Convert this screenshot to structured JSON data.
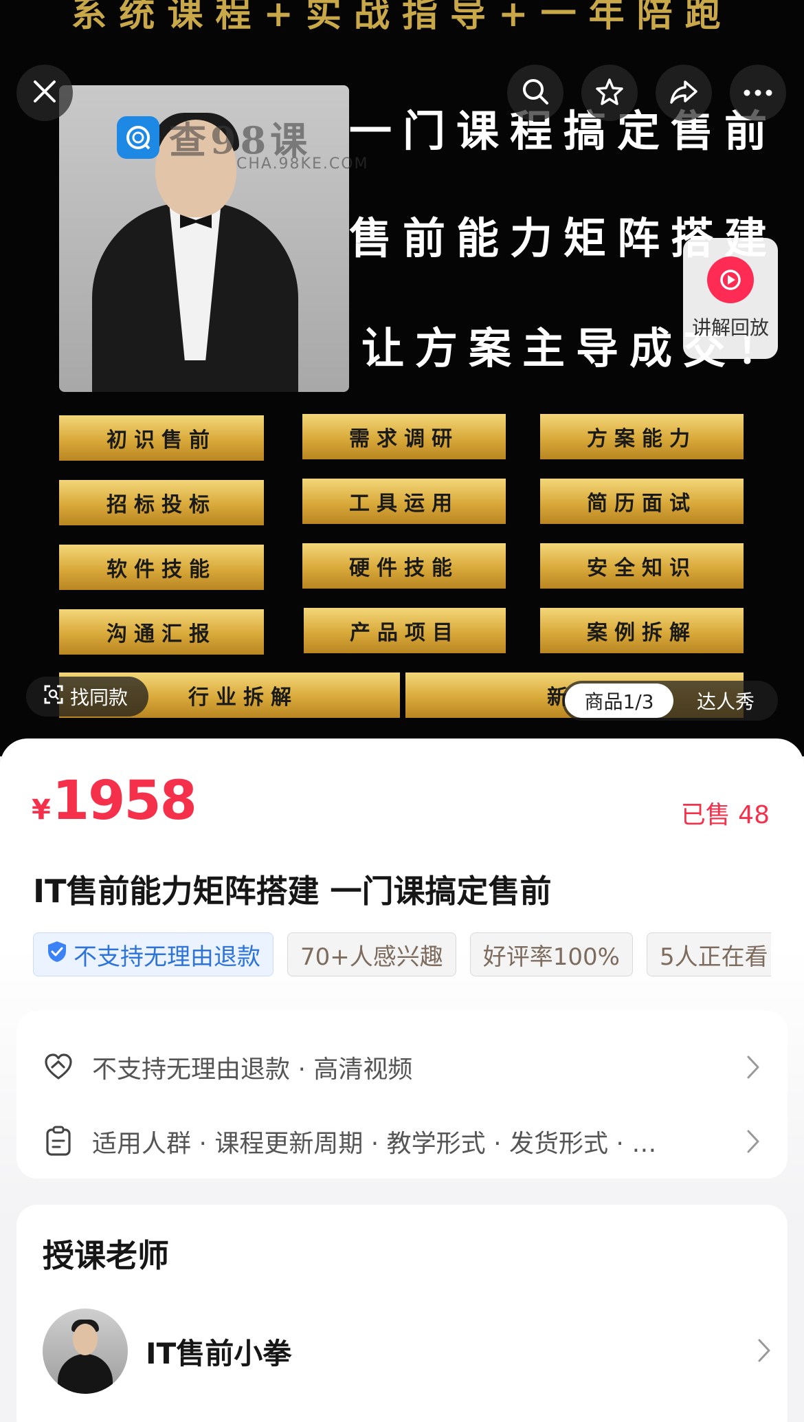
{
  "hero": {
    "banner_top": "系统课程+实战指导+一年陪跑",
    "watermark": {
      "brand": "查98课",
      "url": "CHA.98KE.COM"
    },
    "promo_lines": [
      "一门课程搞定售前",
      "售前能力矩阵搭建",
      "让方案主导成交！"
    ],
    "modules": [
      "初识售前",
      "需求调研",
      "方案能力",
      "招标投标",
      "工具运用",
      "简历面试",
      "软件技能",
      "硬件技能",
      "安全知识",
      "沟通汇报",
      "产品项目",
      "案例拆解",
      "行业拆解",
      "新兴"
    ],
    "top_buttons": [
      "close-icon",
      "search-icon",
      "star-icon",
      "share-icon",
      "more-icon"
    ],
    "replay_label": "讲解回放",
    "find_similar_label": "找同款",
    "media_switch": {
      "active": "商品1/3",
      "inactive": "达人秀"
    }
  },
  "product": {
    "currency": "¥",
    "price": "1958",
    "sold": "已售 48",
    "title": "IT售前能力矩阵搭建 一门课搞定售前",
    "tags": [
      "不支持无理由退款",
      "70+人感兴趣",
      "好评率100%",
      "5人正在看"
    ]
  },
  "service": {
    "rows": [
      "不支持无理由退款 · 高清视频",
      "适用人群 · 课程更新周期 · 教学形式 · 发货形式 · …"
    ]
  },
  "teacher": {
    "section_title": "授课老师",
    "name": "IT售前小拳"
  },
  "colors": {
    "accent": "#f5304b",
    "gold": "#d9a93a",
    "blue_tag": "#2e73d8"
  }
}
